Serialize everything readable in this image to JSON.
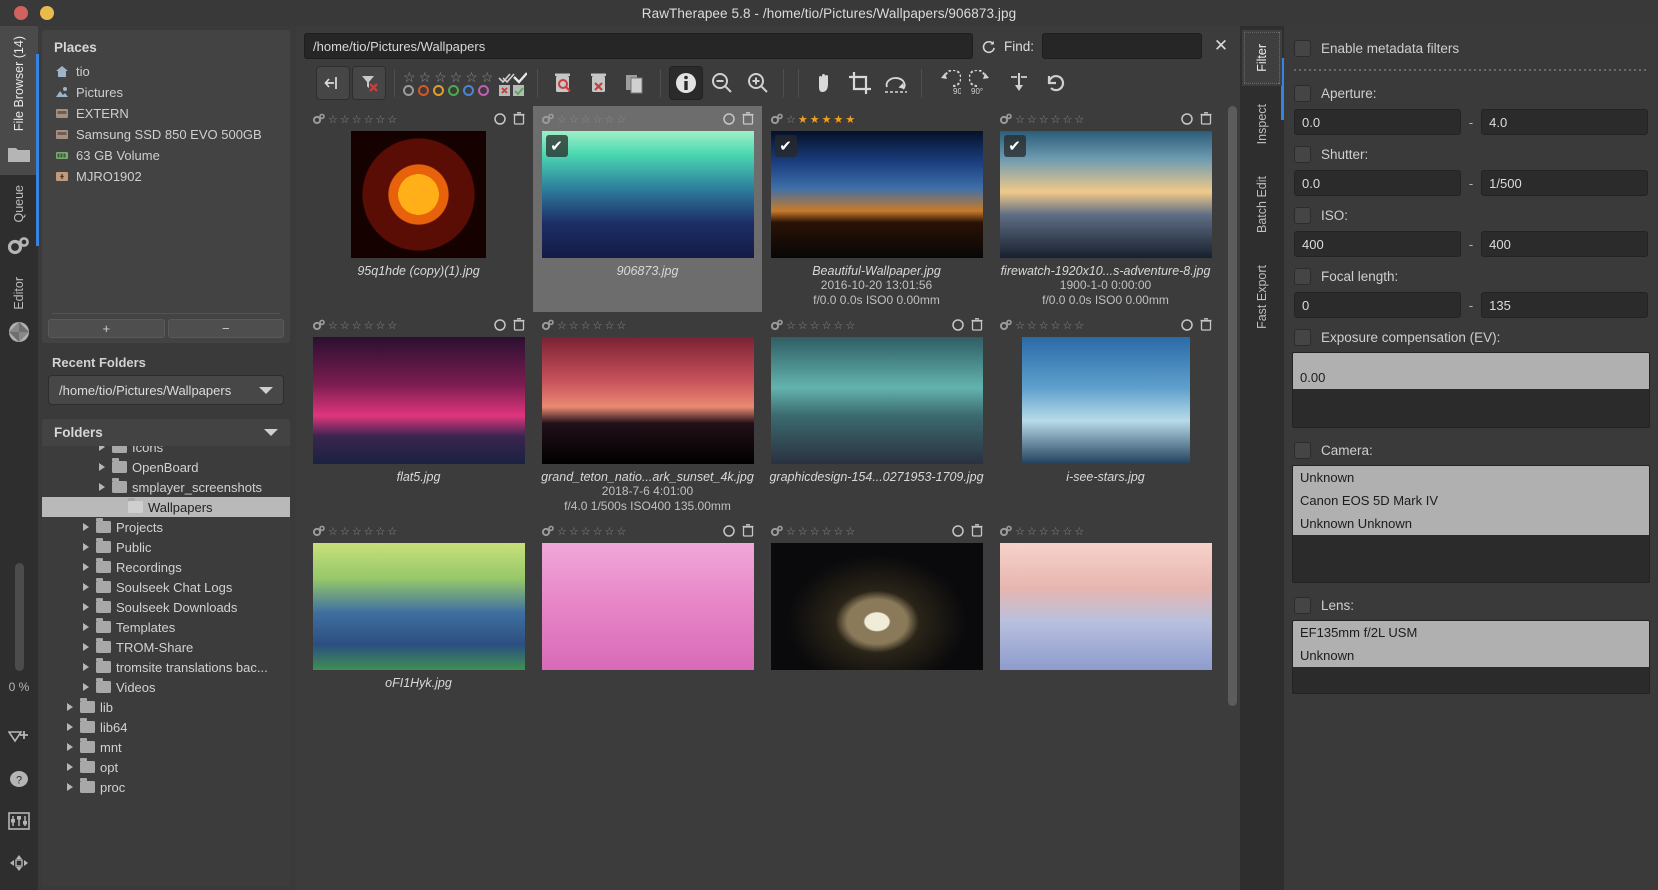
{
  "window": {
    "title": "RawTherapee 5.8 - /home/tio/Pictures/Wallpapers/906873.jpg"
  },
  "rail": {
    "tabs": [
      {
        "label": "File Browser (14)",
        "icon": "folder-icon",
        "active": true
      },
      {
        "label": "Queue",
        "icon": "gears-icon",
        "active": false
      },
      {
        "label": "Editor",
        "icon": "aperture-icon",
        "active": false
      }
    ],
    "progress_label": "0 %",
    "bottom_icons": [
      "send-to-editor-icon",
      "help-icon",
      "preferences-icon",
      "navigator-icon"
    ]
  },
  "places": {
    "title": "Places",
    "items": [
      {
        "label": "tio",
        "icon": "home-icon"
      },
      {
        "label": "Pictures",
        "icon": "pictures-icon"
      },
      {
        "label": "EXTERN",
        "icon": "drive-icon"
      },
      {
        "label": "Samsung SSD 850 EVO 500GB",
        "icon": "drive-icon"
      },
      {
        "label": "63 GB Volume",
        "icon": "volume-icon"
      },
      {
        "label": "MJRO1902",
        "icon": "usb-icon"
      }
    ],
    "add_label": "+",
    "remove_label": "−"
  },
  "recent": {
    "title": "Recent Folders",
    "selected": "/home/tio/Pictures/Wallpapers"
  },
  "folders": {
    "title": "Folders",
    "tree": [
      {
        "label": "Icons",
        "indent": 3,
        "expandable": true,
        "selected": false,
        "clipped": true
      },
      {
        "label": "OpenBoard",
        "indent": 3,
        "expandable": true,
        "selected": false
      },
      {
        "label": "smplayer_screenshots",
        "indent": 3,
        "expandable": true,
        "selected": false
      },
      {
        "label": "Wallpapers",
        "indent": 4,
        "expandable": false,
        "selected": true
      },
      {
        "label": "Projects",
        "indent": 2,
        "expandable": true,
        "selected": false
      },
      {
        "label": "Public",
        "indent": 2,
        "expandable": true,
        "selected": false
      },
      {
        "label": "Recordings",
        "indent": 2,
        "expandable": true,
        "selected": false
      },
      {
        "label": "Soulseek Chat Logs",
        "indent": 2,
        "expandable": true,
        "selected": false
      },
      {
        "label": "Soulseek Downloads",
        "indent": 2,
        "expandable": true,
        "selected": false
      },
      {
        "label": "Templates",
        "indent": 2,
        "expandable": true,
        "selected": false
      },
      {
        "label": "TROM-Share",
        "indent": 2,
        "expandable": true,
        "selected": false
      },
      {
        "label": "tromsite translations bac...",
        "indent": 2,
        "expandable": true,
        "selected": false
      },
      {
        "label": "Videos",
        "indent": 2,
        "expandable": true,
        "selected": false
      },
      {
        "label": "lib",
        "indent": 1,
        "expandable": true,
        "selected": false
      },
      {
        "label": "lib64",
        "indent": 1,
        "expandable": true,
        "selected": false
      },
      {
        "label": "mnt",
        "indent": 1,
        "expandable": true,
        "selected": false
      },
      {
        "label": "opt",
        "indent": 1,
        "expandable": true,
        "selected": false
      },
      {
        "label": "proc",
        "indent": 1,
        "expandable": true,
        "selected": false
      }
    ]
  },
  "browser": {
    "path_value": "/home/tio/Pictures/Wallpapers",
    "refresh_icon": "refresh-icon",
    "find_label": "Find:",
    "find_value": "",
    "clear_label": "✕",
    "toolbar": [
      {
        "name": "show-hide-left-panel",
        "icon": "collapse-panel-icon",
        "style": "framed"
      },
      {
        "name": "clear-filters",
        "icon": "funnel-clear-icon",
        "style": "framed"
      },
      {
        "name": "rank-filter",
        "icon": "stars-and-colors-icon",
        "style": "plain"
      },
      {
        "name": "unedited-edited-filter",
        "icon": "double-check-icon",
        "style": "plain"
      },
      {
        "name": "trash-filter",
        "icon": "trash-search-icon",
        "style": "plain"
      },
      {
        "name": "empty-trash",
        "icon": "trash-clear-icon",
        "style": "plain"
      },
      {
        "name": "copy-profile",
        "icon": "copy-profile-icon",
        "style": "plain"
      },
      {
        "name": "toggle-file-info",
        "icon": "info-icon",
        "style": "active"
      },
      {
        "name": "zoom-out",
        "icon": "zoom-out-icon",
        "style": "plain"
      },
      {
        "name": "zoom-in",
        "icon": "zoom-in-icon",
        "style": "plain"
      },
      {
        "name": "hand-tool",
        "icon": "hand-icon",
        "style": "plain"
      },
      {
        "name": "crop-tool",
        "icon": "crop-icon",
        "style": "plain"
      },
      {
        "name": "straighten-tool",
        "icon": "straighten-icon",
        "style": "plain"
      },
      {
        "name": "rotate-left",
        "icon": "rotate-left-90-icon",
        "style": "plain"
      },
      {
        "name": "rotate-right",
        "icon": "rotate-right-90-icon",
        "style": "plain"
      },
      {
        "name": "flip-vertical",
        "icon": "flip-vertical-icon",
        "style": "plain"
      },
      {
        "name": "undo",
        "icon": "undo-icon",
        "style": "plain"
      }
    ],
    "star_filter_count": 6,
    "color_labels": [
      "#9a9a9a",
      "#d05a2a",
      "#e0a020",
      "#4eaa4e",
      "#4a84d8",
      "#c060b0"
    ],
    "thumbnails": [
      {
        "filename": "95q1hde (copy)(1).jpg",
        "datetime": "",
        "exif": "",
        "stars": 0,
        "selected": false,
        "checked": false,
        "theme": "sun"
      },
      {
        "filename": "906873.jpg",
        "datetime": "",
        "exif": "",
        "stars": 0,
        "selected": true,
        "checked": true,
        "theme": "forest-aurora"
      },
      {
        "filename": "Beautiful-Wallpaper.jpg",
        "datetime": "2016-10-20 13:01:56",
        "exif": "f/0.0 0.0s ISO0 0.00mm",
        "stars": 5,
        "selected": false,
        "checked": true,
        "theme": "milkyway"
      },
      {
        "filename": "firewatch-1920x10...s-adventure-8.jpg",
        "datetime": "1900-1-0 0:00:00",
        "exif": "f/0.0 0.0s ISO0 0.00mm",
        "stars": 0,
        "selected": false,
        "checked": true,
        "theme": "firewatch"
      },
      {
        "filename": "flat5.jpg",
        "datetime": "",
        "exif": "",
        "stars": 0,
        "selected": false,
        "checked": false,
        "theme": "flat-pink"
      },
      {
        "filename": "grand_teton_natio...ark_sunset_4k.jpg",
        "datetime": "2018-7-6 4:01:00",
        "exif": "f/4.0 1/500s ISO400 135.00mm",
        "stars": 0,
        "selected": false,
        "checked": false,
        "theme": "teton"
      },
      {
        "filename": "graphicdesign-154...0271953-1709.jpg",
        "datetime": "",
        "exif": "",
        "stars": 0,
        "selected": false,
        "checked": false,
        "theme": "teal-peaks"
      },
      {
        "filename": "i-see-stars.jpg",
        "datetime": "",
        "exif": "",
        "stars": 0,
        "selected": false,
        "checked": false,
        "theme": "see-stars"
      },
      {
        "filename": "oFI1Hyk.jpg",
        "datetime": "",
        "exif": "",
        "stars": 0,
        "selected": false,
        "checked": false,
        "theme": "green-mountains"
      },
      {
        "filename": "",
        "datetime": "",
        "exif": "",
        "stars": 0,
        "selected": false,
        "checked": false,
        "theme": "pink-flat"
      },
      {
        "filename": "",
        "datetime": "",
        "exif": "",
        "stars": 0,
        "selected": false,
        "checked": false,
        "theme": "galaxy"
      },
      {
        "filename": "",
        "datetime": "",
        "exif": "",
        "stars": 0,
        "selected": false,
        "checked": false,
        "theme": "pale-mountains"
      }
    ]
  },
  "rightrail": {
    "tabs": [
      {
        "label": "Filter",
        "active": true
      },
      {
        "label": "Inspect",
        "active": false
      },
      {
        "label": "Batch Edit",
        "active": false
      },
      {
        "label": "Fast Export",
        "active": false
      }
    ]
  },
  "filter": {
    "enable_label": "Enable metadata filters",
    "aperture": {
      "label": "Aperture:",
      "min": "0.0",
      "max": "4.0"
    },
    "shutter": {
      "label": "Shutter:",
      "min": "0.0",
      "max": "1/500"
    },
    "iso": {
      "label": "ISO:",
      "min": "400",
      "max": "400"
    },
    "focal": {
      "label": "Focal length:",
      "min": "0",
      "max": "135"
    },
    "exposure": {
      "label": "Exposure compensation (EV):",
      "values": [
        "0.00"
      ]
    },
    "camera": {
      "label": "Camera:",
      "values": [
        "Unknown",
        "Canon EOS 5D Mark IV",
        "Unknown Unknown"
      ]
    },
    "lens": {
      "label": "Lens:",
      "values": [
        "EF135mm f/2L USM",
        "Unknown"
      ]
    },
    "dash": "-"
  }
}
